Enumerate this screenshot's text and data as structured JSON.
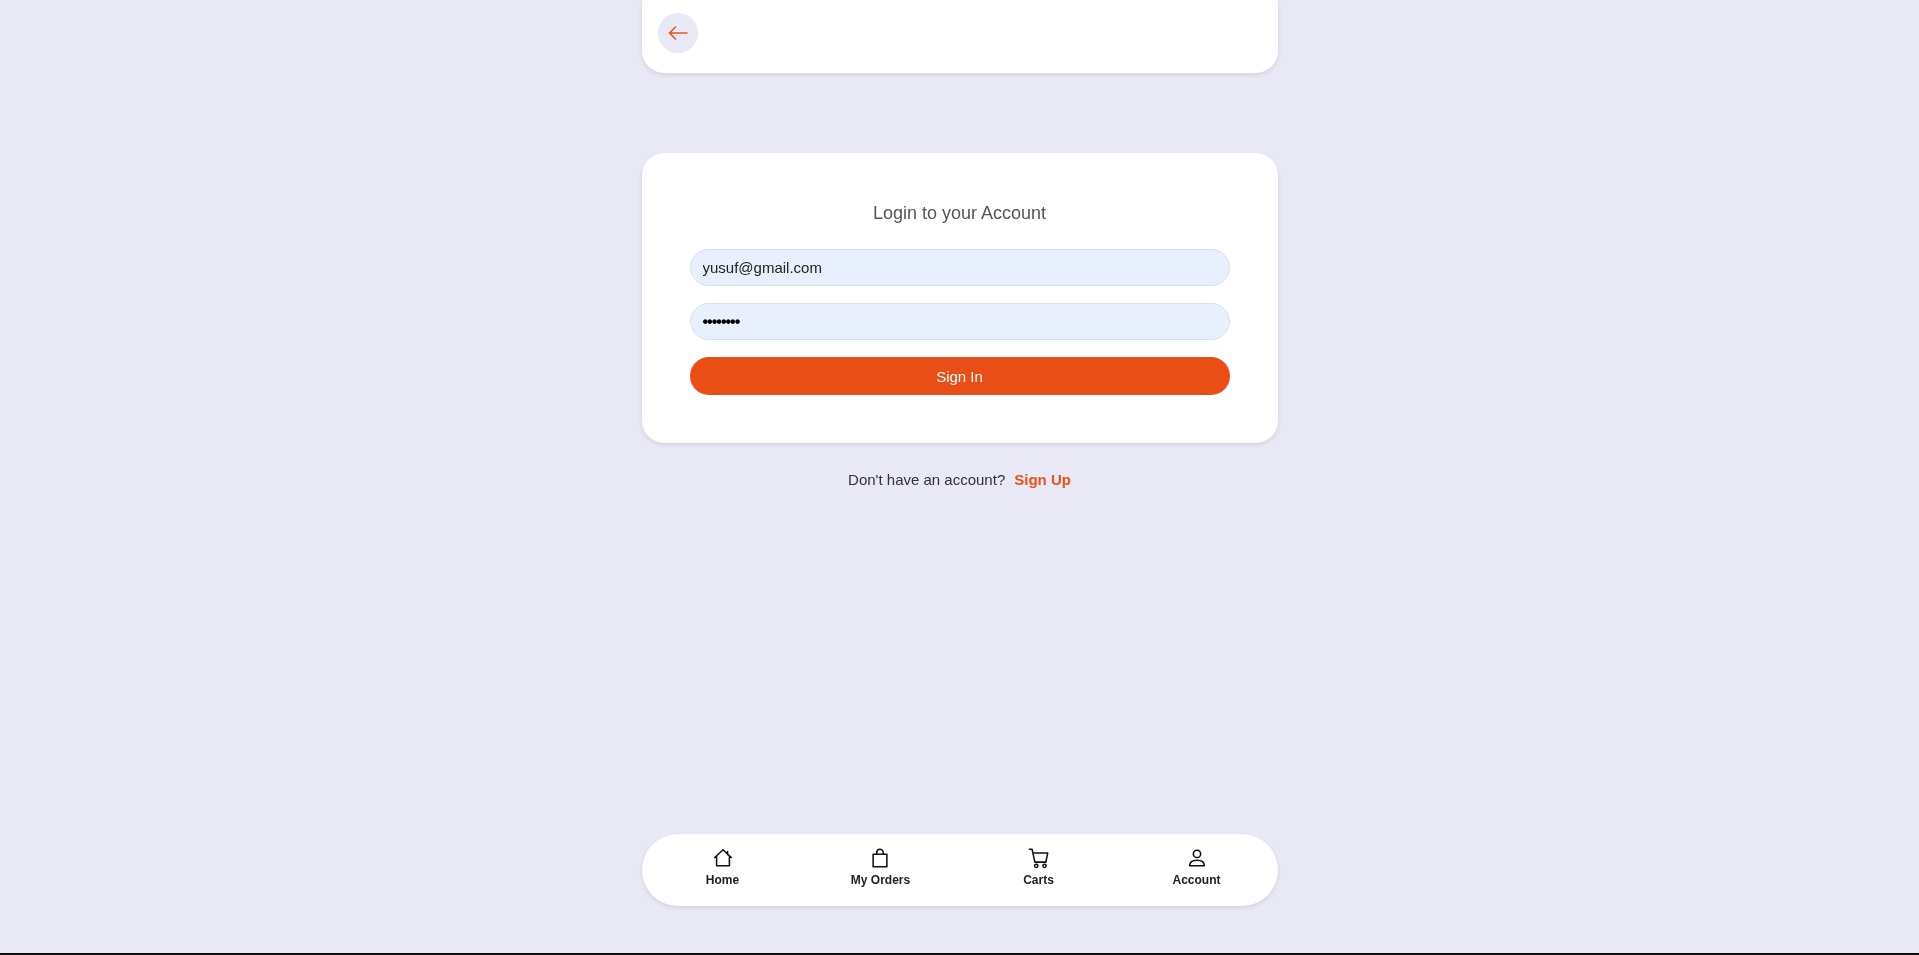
{
  "login_card": {
    "title": "Login to your Account",
    "email": {
      "value": "yusuf@gmail.com"
    },
    "password": {
      "value": "••••••••"
    },
    "submit": "Sign In"
  },
  "signup_prompt": {
    "text": "Don't have an account?",
    "link": "Sign Up"
  },
  "bottom_nav": [
    {
      "label": "Home"
    },
    {
      "label": "My Orders"
    },
    {
      "label": "Carts"
    },
    {
      "label": "Account"
    }
  ]
}
